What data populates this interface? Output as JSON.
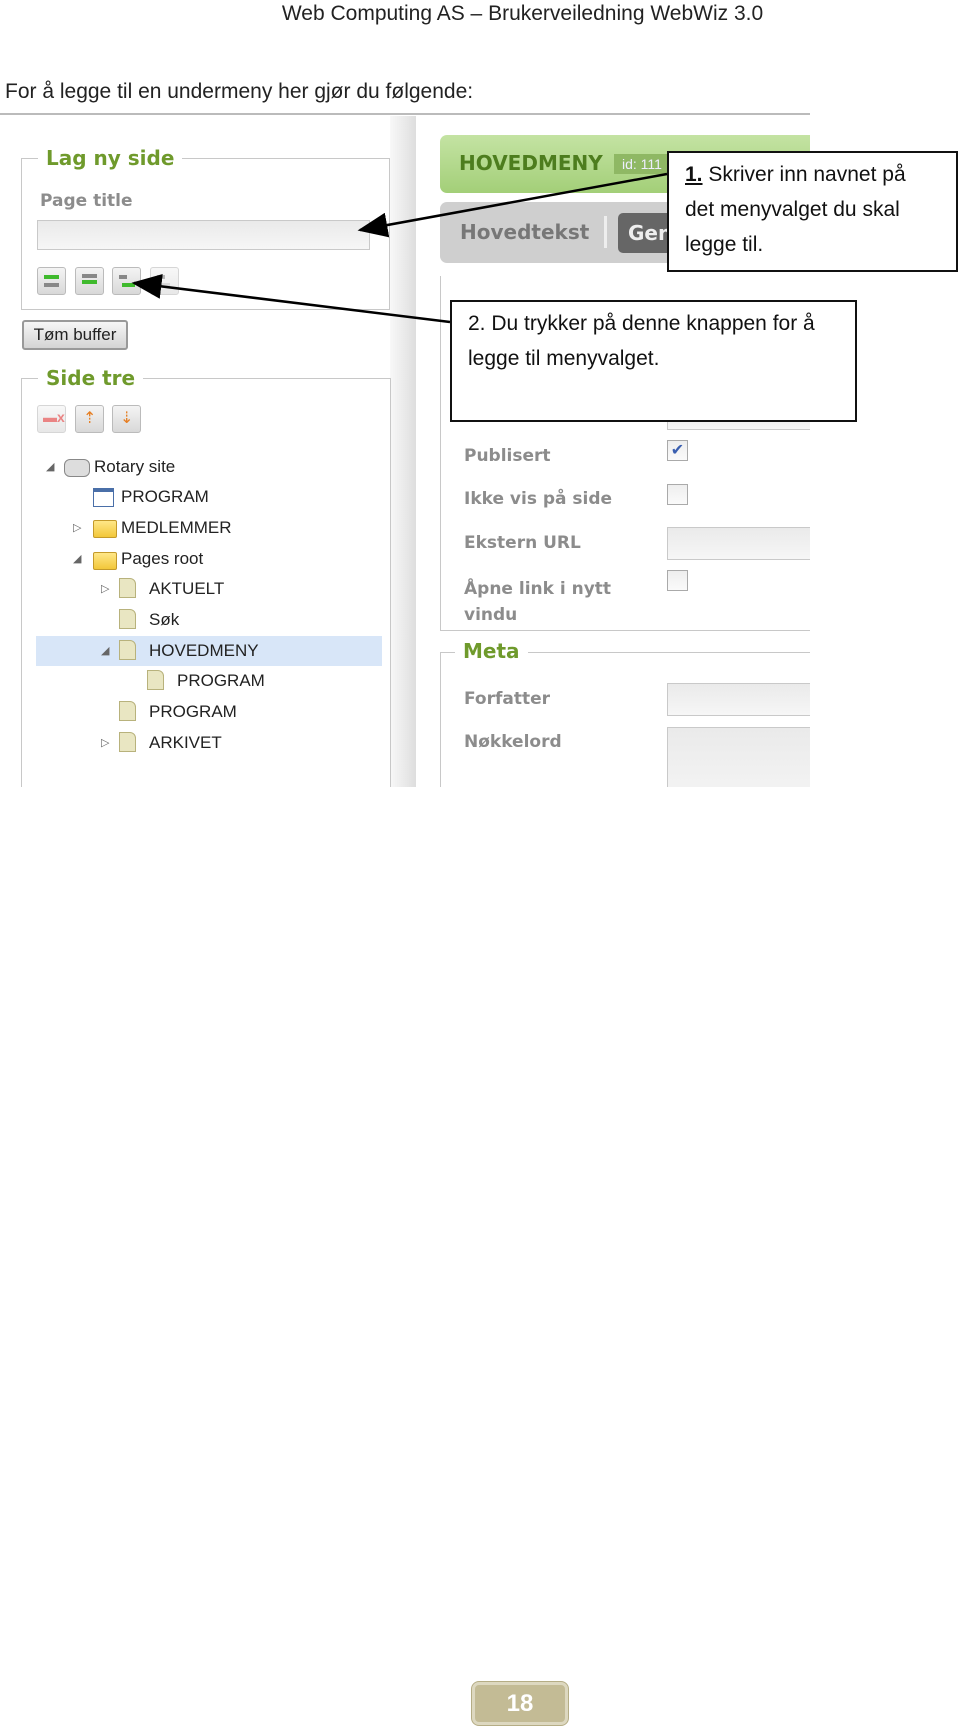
{
  "header": {
    "title": "Web Computing AS – Brukerveiledning WebWiz 3.0"
  },
  "intro": "For å legge til en undermeny her gjør du følgende:",
  "left_panel": {
    "new_page": {
      "legend": "Lag ny side",
      "page_title_label": "Page title",
      "page_title_value": "",
      "buttons": [
        "add-before-icon",
        "add-after-icon",
        "add-child-icon",
        "add-disabled-icon"
      ]
    },
    "clear_buffer": "Tøm buffer",
    "tree": {
      "legend": "Side tre",
      "items": [
        {
          "label": "Rotary site",
          "icon": "site-stack-icon",
          "expanded": true
        },
        {
          "label": "PROGRAM",
          "icon": "list-page-icon"
        },
        {
          "label": "MEDLEMMER",
          "icon": "folder-icon",
          "expanded": false
        },
        {
          "label": "Pages root",
          "icon": "open-folder-icon",
          "expanded": true
        },
        {
          "label": "AKTUELT",
          "icon": "page-icon",
          "expanded": false
        },
        {
          "label": "Søk",
          "icon": "page-icon"
        },
        {
          "label": "HOVEDMENY",
          "icon": "page-icon",
          "expanded": true,
          "selected": true
        },
        {
          "label": "PROGRAM",
          "icon": "page-icon"
        },
        {
          "label": "PROGRAM",
          "icon": "page-icon"
        },
        {
          "label": "ARKIVET",
          "icon": "page-icon",
          "expanded": false
        }
      ]
    }
  },
  "right_panel": {
    "page_header": {
      "title": "HOVEDMENY",
      "id_badge": "id: 111"
    },
    "tabs": [
      {
        "label": "Hovedtekst"
      },
      {
        "label": "Gen",
        "active": true
      }
    ],
    "fields": {
      "publisert": {
        "label": "Publisert",
        "checked": true
      },
      "ikke_vis": {
        "label": "Ikke vis på side",
        "checked": false
      },
      "ekstern_url": {
        "label": "Ekstern URL",
        "value": ""
      },
      "apne_link": {
        "label": "Åpne link i nytt vindu",
        "checked": false
      }
    },
    "meta": {
      "legend": "Meta",
      "forfatter": "Forfatter",
      "nokkelord": "Nøkkelord"
    }
  },
  "callouts": {
    "one_num": "1.",
    "one_text": " Skriver inn navnet på det menyvalget du skal legge til.",
    "two_text": "2. Du trykker på denne knappen for å legge til menyvalget."
  },
  "footer": {
    "page_number": "18"
  },
  "colors": {
    "legend_green": "#6f9a2c",
    "header_green": "#a9d17e",
    "selected_row": "#d8e6f8",
    "page_badge": "#c3bb95"
  }
}
